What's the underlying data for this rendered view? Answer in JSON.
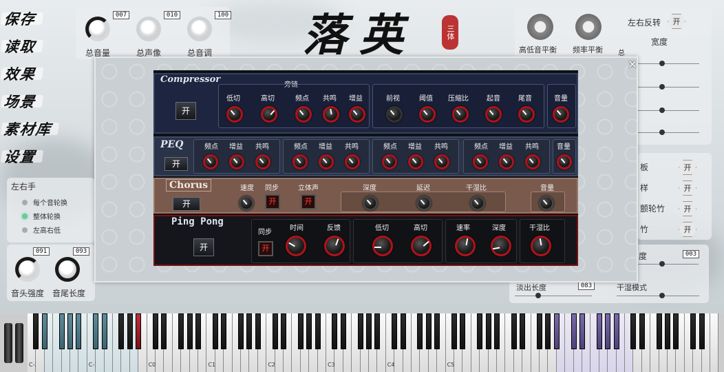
{
  "menu": [
    "保存",
    "读取",
    "效果",
    "场景",
    "素材库",
    "设置"
  ],
  "logo": {
    "title": "落英",
    "seal": "三体"
  },
  "top_knobs": [
    {
      "label": "总音量",
      "value": "007"
    },
    {
      "label": "总声像",
      "value": "010"
    },
    {
      "label": "总音调",
      "value": "100"
    }
  ],
  "right_top": {
    "balance_hl": "高低音平衡",
    "balance_freq": "频率平衡",
    "lr_flip": "左右反转",
    "lr_flip_btn": "开",
    "width": "宽度",
    "total": "总"
  },
  "right_mid": {
    "item1": "板",
    "item2": "样",
    "item3": "颤轮竹",
    "item4": "竹",
    "btn": "开"
  },
  "right_low": {
    "depth": "度",
    "depth_value": "003",
    "fade_out": "淡出长度",
    "fade_value": "083",
    "dry_mode": "干湿模式"
  },
  "left_panel": {
    "title": "左右手",
    "options": [
      "每个音轮换",
      "整体轮换",
      "左高右低"
    ],
    "knob1_label": "音头强度",
    "knob1_value": "091",
    "knob2_label": "音尾长度",
    "knob2_value": "093"
  },
  "modal": {
    "close": "✕"
  },
  "compressor": {
    "title": "Compressor",
    "on": "开",
    "sidechain": "旁链",
    "labels": [
      "低切",
      "高切",
      "频点",
      "共鸣",
      "增益",
      "前视",
      "阈值",
      "压缩比",
      "起音",
      "尾音",
      "音量"
    ]
  },
  "peq": {
    "title": "PEQ",
    "on": "开",
    "band_labels": [
      "频点",
      "增益",
      "共鸣"
    ],
    "volume": "音量"
  },
  "chorus": {
    "title": "Chorus",
    "on": "开",
    "labels": {
      "speed": "速度",
      "sync": "同步",
      "stereo": "立体声",
      "depth": "深度",
      "delay": "延迟",
      "drywet": "干湿比",
      "volume": "音量"
    },
    "sync_btn": "开",
    "stereo_btn": "开"
  },
  "pingpong": {
    "title": "Ping Pong",
    "on": "开",
    "sync_btn": "开",
    "labels": {
      "sync": "同步",
      "time": "时间",
      "feedback": "反馈",
      "lowcut": "低切",
      "highcut": "高切",
      "rate": "速率",
      "depth": "深度",
      "drywet": "干湿比"
    }
  },
  "piano": {
    "octaves": [
      "C-2",
      "C-1",
      "C0",
      "C1",
      "C2",
      "C3",
      "C4",
      "C5"
    ]
  },
  "colors": {
    "accent_red": "#b0121a",
    "teal_keys": "#5f8c9a",
    "purple_keys": "#7a6aa8"
  }
}
